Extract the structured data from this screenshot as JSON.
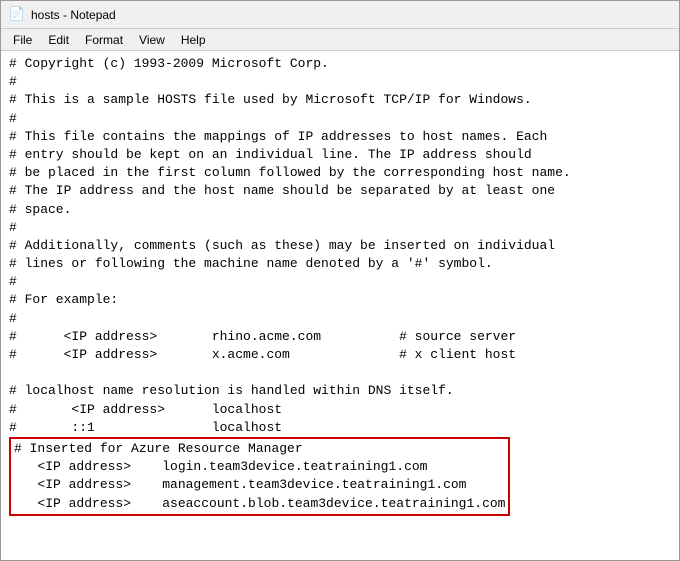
{
  "titleBar": {
    "title": "hosts - Notepad",
    "iconSymbol": "📄"
  },
  "menuBar": {
    "items": [
      "File",
      "Edit",
      "Format",
      "View",
      "Help"
    ]
  },
  "content": {
    "lines": [
      "# Copyright (c) 1993-2009 Microsoft Corp.",
      "#",
      "# This is a sample HOSTS file used by Microsoft TCP/IP for Windows.",
      "#",
      "# This file contains the mappings of IP addresses to host names. Each",
      "# entry should be kept on an individual line. The IP address should",
      "# be placed in the first column followed by the corresponding host name.",
      "# The IP address and the host name should be separated by at least one",
      "# space.",
      "#",
      "# Additionally, comments (such as these) may be inserted on individual",
      "# lines or following the machine name denoted by a '#' symbol.",
      "#",
      "# For example:",
      "#",
      "#      <IP address>       rhino.acme.com          # source server",
      "#      <IP address>       x.acme.com              # x client host",
      "",
      "# localhost name resolution is handled within DNS itself.",
      "#       <IP address>      localhost",
      "#       ::1               localhost"
    ],
    "highlightedLines": [
      "# Inserted for Azure Resource Manager",
      "   <IP address>    login.team3device.teatraining1.com",
      "   <IP address>    management.team3device.teatraining1.com",
      "   <IP address>    aseaccount.blob.team3device.teatraining1.com"
    ]
  }
}
